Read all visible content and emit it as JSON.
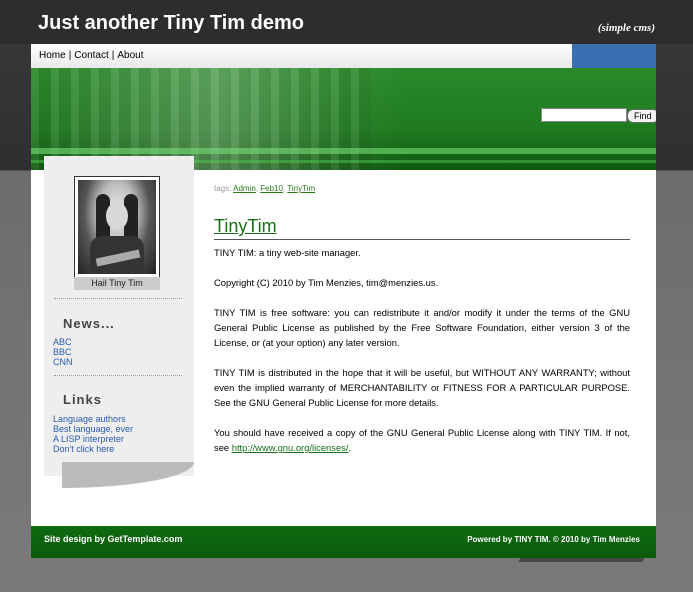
{
  "site": {
    "title": "Just another Tiny Tim demo",
    "tagline": "(simple cms)"
  },
  "nav": {
    "items": [
      "Home",
      "Contact",
      "About"
    ],
    "separator": "|"
  },
  "search": {
    "placeholder": "",
    "button_label": "Find"
  },
  "sidebar": {
    "photo_caption": "Hail Tiny Tim",
    "news_title": "News...",
    "news_items": [
      "ABC",
      "BBC",
      "CNN"
    ],
    "links_title": "Links",
    "links_items": [
      "Language authors",
      "Best language, ever",
      "A LISP interpreter",
      "Don't click here"
    ]
  },
  "post": {
    "tags_label": "tags:",
    "tags": [
      "Admin",
      "Feb10",
      "TinyTim"
    ],
    "title": "TinyTim",
    "paragraphs": [
      "TINY TIM: a tiny web-site manager.",
      "Copyright (C) 2010 by Tim Menzies, tim@menzies.us.",
      "TINY TIM is free software: you can redistribute it and/or modify it under the terms of the GNU General Public License as published by the Free Software Foundation, either version 3 of the License, or (at your option) any later version.",
      "TINY TIM is distributed in the hope that it will be useful, but WITHOUT ANY WARRANTY; without even the implied warranty of MERCHANTABILITY or FITNESS FOR A PARTICULAR PURPOSE. See the GNU General Public License for more details."
    ],
    "last_paragraph_text": "You should have received a copy of the GNU General Public License along with TINY TIM. If not, see",
    "license_link": "http://www.gnu.org/licenses/",
    "last_paragraph_end": "."
  },
  "footer": {
    "left": "Site design by GetTemplate.com",
    "right": "Powered by TINY TIM. © 2010 by Tim Menzies"
  },
  "colors": {
    "green": "#1a6e1a",
    "link_blue": "#2a5db0",
    "accent_blue": "#3a6fb2"
  }
}
